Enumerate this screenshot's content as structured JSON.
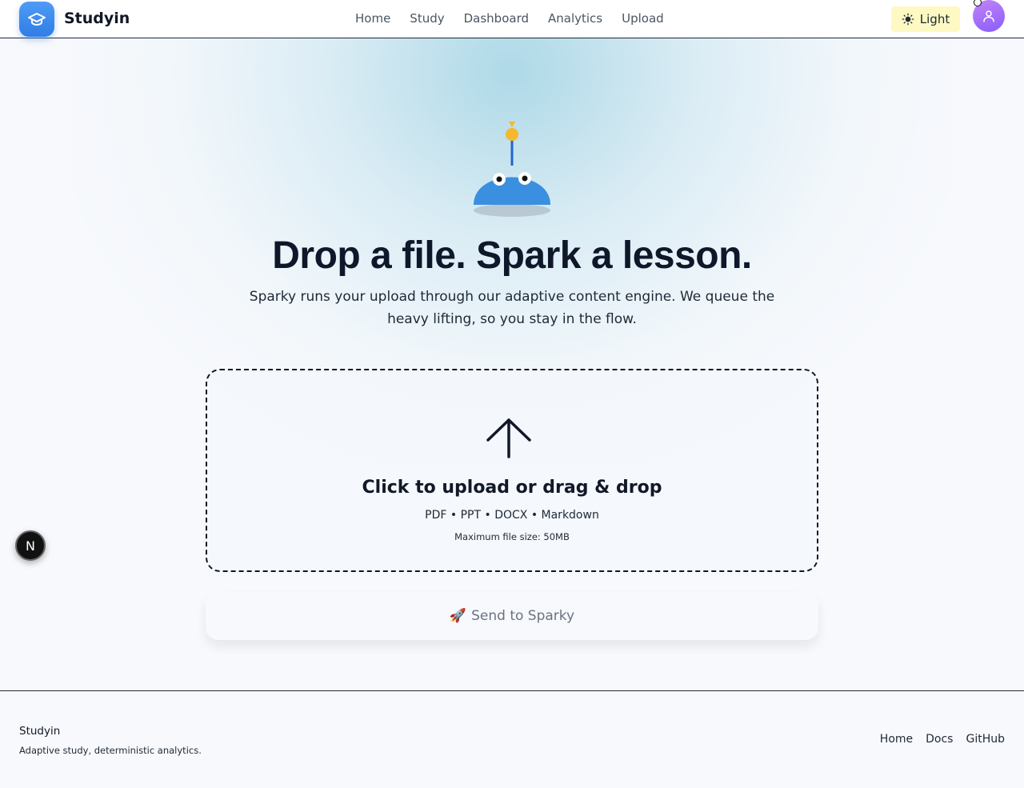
{
  "header": {
    "brand": "Studyin",
    "nav": [
      "Home",
      "Study",
      "Dashboard",
      "Analytics",
      "Upload"
    ],
    "theme_label": "Light"
  },
  "hero": {
    "headline": "Drop a file. Spark a lesson.",
    "subtext": "Sparky runs your upload through our adaptive content engine. We queue the heavy lifting, so you stay in the flow."
  },
  "dropzone": {
    "title": "Click to upload or drag & drop",
    "types": "PDF • PPT • DOCX • Markdown",
    "max_size": "Maximum file size: 50MB"
  },
  "send_button": {
    "icon": "🚀",
    "label": "Send to Sparky"
  },
  "floating_badge": "N",
  "footer": {
    "brand": "Studyin",
    "tagline": "Adaptive study, deterministic analytics.",
    "links": [
      "Home",
      "Docs",
      "GitHub"
    ]
  },
  "colors": {
    "accent": "#2f7de6",
    "theme_button_bg": "#fef9c3",
    "avatar": "#a855f7"
  }
}
